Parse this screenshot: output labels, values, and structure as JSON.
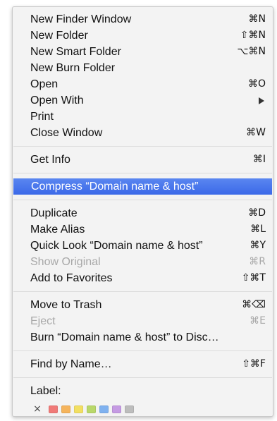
{
  "menu": {
    "groups": [
      [
        {
          "label": "New Finder Window",
          "shortcut": "⌘N"
        },
        {
          "label": "New Folder",
          "shortcut": "⇧⌘N"
        },
        {
          "label": "New Smart Folder",
          "shortcut": "⌥⌘N"
        },
        {
          "label": "New Burn Folder",
          "shortcut": ""
        },
        {
          "label": "Open",
          "shortcut": "⌘O"
        },
        {
          "label": "Open With",
          "shortcut": ""
        },
        {
          "label": "Print",
          "shortcut": ""
        },
        {
          "label": "Close Window",
          "shortcut": "⌘W"
        }
      ],
      [
        {
          "label": "Get Info",
          "shortcut": "⌘I"
        }
      ],
      [
        {
          "label": "Compress “Domain name & host”",
          "shortcut": ""
        }
      ],
      [
        {
          "label": "Duplicate",
          "shortcut": "⌘D"
        },
        {
          "label": "Make Alias",
          "shortcut": "⌘L"
        },
        {
          "label": "Quick Look “Domain name & host”",
          "shortcut": "⌘Y"
        },
        {
          "label": "Show Original",
          "shortcut": "⌘R"
        },
        {
          "label": "Add to Favorites",
          "shortcut": "⇧⌘T"
        }
      ],
      [
        {
          "label": "Move to Trash",
          "shortcut": "⌘⌫"
        },
        {
          "label": "Eject",
          "shortcut": "⌘E"
        },
        {
          "label": "Burn “Domain name & host” to Disc…",
          "shortcut": ""
        }
      ],
      [
        {
          "label": "Find by Name…",
          "shortcut": "⇧⌘F"
        }
      ]
    ],
    "label_section": {
      "title": "Label:",
      "none_symbol": "×",
      "colors": [
        {
          "name": "red",
          "hex": "#f07a78"
        },
        {
          "name": "orange",
          "hex": "#f5b45c"
        },
        {
          "name": "yellow",
          "hex": "#f2df62"
        },
        {
          "name": "green",
          "hex": "#b9d86a"
        },
        {
          "name": "blue",
          "hex": "#7fb1ef"
        },
        {
          "name": "purple",
          "hex": "#c59be3"
        },
        {
          "name": "gray",
          "hex": "#bdbdbd"
        }
      ]
    },
    "accent_highlight": "#3b69e8"
  }
}
